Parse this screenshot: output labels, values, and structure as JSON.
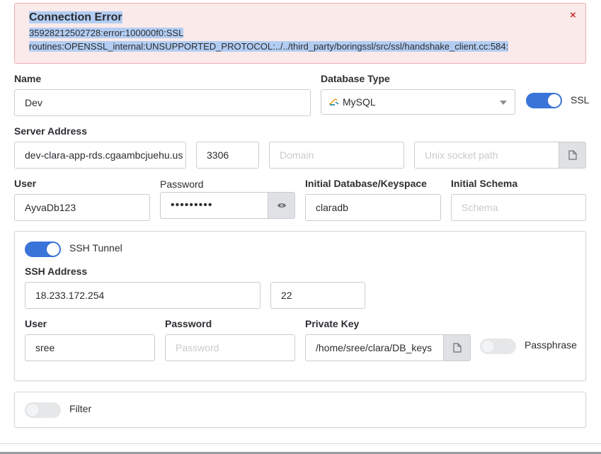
{
  "alert": {
    "title": "Connection Error",
    "line1": "35928212502728:error:100000f0:SSL",
    "line2": "routines:OPENSSL_internal:UNSUPPORTED_PROTOCOL:../../third_party/boringssl/src/ssl/handshake_client.cc:584:",
    "close": "×"
  },
  "name": {
    "label": "Name",
    "value": "Dev"
  },
  "db_type": {
    "label": "Database Type",
    "value": "MySQL"
  },
  "ssl": {
    "label": "SSL",
    "enabled": true
  },
  "server": {
    "label": "Server Address",
    "host": "dev-clara-app-rds.cgaambcjuehu.us",
    "port": "3306",
    "domain_placeholder": "Domain",
    "socket_placeholder": "Unix socket path"
  },
  "user": {
    "label": "User",
    "value": "AyvaDb123"
  },
  "password": {
    "label": "Password",
    "value": "•••••••••"
  },
  "initial_db": {
    "label": "Initial Database/Keyspace",
    "value": "claradb"
  },
  "initial_schema": {
    "label": "Initial Schema",
    "placeholder": "Schema"
  },
  "ssh": {
    "toggle_label": "SSH Tunnel",
    "enabled": true,
    "address_label": "SSH Address",
    "address": "18.233.172.254",
    "port": "22",
    "user_label": "User",
    "user": "sree",
    "password_label": "Password",
    "password_placeholder": "Password",
    "private_key_label": "Private Key",
    "private_key": "/home/sree/clara/DB_keys",
    "passphrase_label": "Passphrase",
    "passphrase_enabled": false
  },
  "filter": {
    "label": "Filter",
    "enabled": false
  },
  "colors": {
    "accent": "#3a74d9",
    "error_bg": "#fbeaea",
    "error_border": "#e9aeb1",
    "close": "#c4343c"
  },
  "icons": {
    "file": "file-icon",
    "eye": "eye-icon",
    "close": "close-icon",
    "mysql": "mysql-logo-icon"
  }
}
